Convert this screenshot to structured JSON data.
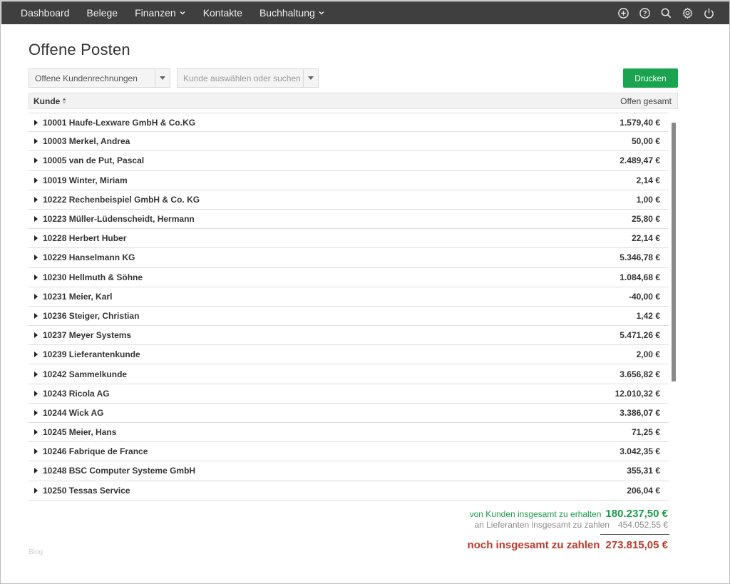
{
  "nav": {
    "items": [
      "Dashboard",
      "Belege",
      "Finanzen",
      "Kontakte",
      "Buchhaltung"
    ],
    "icons": [
      "plus-circle-icon",
      "help-icon",
      "search-icon",
      "gear-icon",
      "power-icon"
    ]
  },
  "page": {
    "title": "Offene Posten"
  },
  "filters": {
    "type_value": "Offene Kundenrechnungen",
    "customer_placeholder": "Kunde auswählen oder suchen"
  },
  "actions": {
    "print_label": "Drucken"
  },
  "table": {
    "col_customer": "Kunde",
    "col_open_total": "Offen gesamt",
    "rows": [
      {
        "name": "10001 Haufe-Lexware GmbH & Co.KG",
        "amount": "1.579,40 €"
      },
      {
        "name": "10003 Merkel, Andrea",
        "amount": "50,00 €"
      },
      {
        "name": "10005 van de Put, Pascal",
        "amount": "2.489,47 €"
      },
      {
        "name": "10019 Winter, Miriam",
        "amount": "2,14 €"
      },
      {
        "name": "10222 Rechenbeispiel GmbH & Co. KG",
        "amount": "1,00 €"
      },
      {
        "name": "10223 Müller-Lüdenscheidt, Hermann",
        "amount": "25,80 €"
      },
      {
        "name": "10228 Herbert Huber",
        "amount": "22,14 €"
      },
      {
        "name": "10229 Hanselmann KG",
        "amount": "5.346,78 €"
      },
      {
        "name": "10230 Hellmuth & Söhne",
        "amount": "1.084,68 €"
      },
      {
        "name": "10231 Meier, Karl",
        "amount": "-40,00 €"
      },
      {
        "name": "10236 Steiger, Christian",
        "amount": "1,42 €"
      },
      {
        "name": "10237 Meyer Systems",
        "amount": "5.471,26 €"
      },
      {
        "name": "10239 Lieferantenkunde",
        "amount": "2,00 €"
      },
      {
        "name": "10242 Sammelkunde",
        "amount": "3.656,82 €"
      },
      {
        "name": "10243 Ricola AG",
        "amount": "12.010,32 €"
      },
      {
        "name": "10244 Wick AG",
        "amount": "3.386,07 €"
      },
      {
        "name": "10245 Meier, Hans",
        "amount": "71,25 €"
      },
      {
        "name": "10246 Fabrique de France",
        "amount": "3.042,35 €"
      },
      {
        "name": "10248 BSC Computer Systeme GmbH",
        "amount": "355,31 €"
      },
      {
        "name": "10250 Tessas Service",
        "amount": "206,04 €"
      }
    ]
  },
  "totals": {
    "receivable_label": "von Kunden insgesamt zu erhalten",
    "receivable_value": "180.237,50 €",
    "payable_label": "an Lieferanten insgesamt zu zahlen",
    "payable_value": "454.052,55 €",
    "net_label": "noch insgesamt zu zahlen",
    "net_value": "273.815,05 €"
  },
  "footer": {
    "blog_label": "Blog"
  },
  "colors": {
    "topbar": "#3f3f3f",
    "accent_green": "#1ba44f",
    "net_red": "#c0392b"
  }
}
